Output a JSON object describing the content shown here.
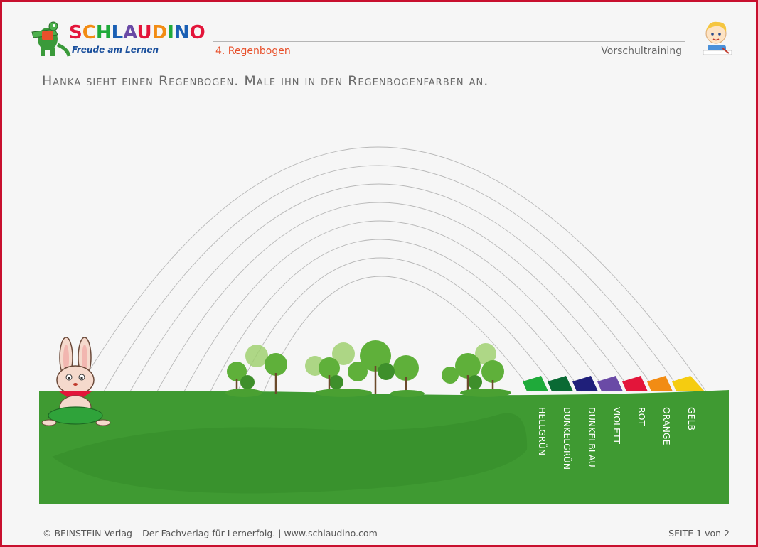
{
  "header": {
    "brand": "SCHLAUDINO",
    "tagline": "Freude am Lernen",
    "lesson": "4. Regenbogen",
    "program": "Vorschultraining"
  },
  "instruction": "Hanka sieht einen Regenbogen. Male ihn in den Regenbogenfarben an.",
  "colors": [
    {
      "label": "HELLGRÜN",
      "hex": "#1faa3a"
    },
    {
      "label": "DUNKELGRÜN",
      "hex": "#0a6a34"
    },
    {
      "label": "DUNKELBLAU",
      "hex": "#1f1f7a"
    },
    {
      "label": "VIOLETT",
      "hex": "#6a4aa6"
    },
    {
      "label": "ROT",
      "hex": "#e3153a"
    },
    {
      "label": "ORANGE",
      "hex": "#f28c14"
    },
    {
      "label": "GELB",
      "hex": "#f5cc10"
    }
  ],
  "footer": {
    "left": "© BEINSTEIN Verlag – Der Fachverlag für Lernerfolg.  |  www.schlaudino.com",
    "right": "SEITE 1 von 2"
  }
}
